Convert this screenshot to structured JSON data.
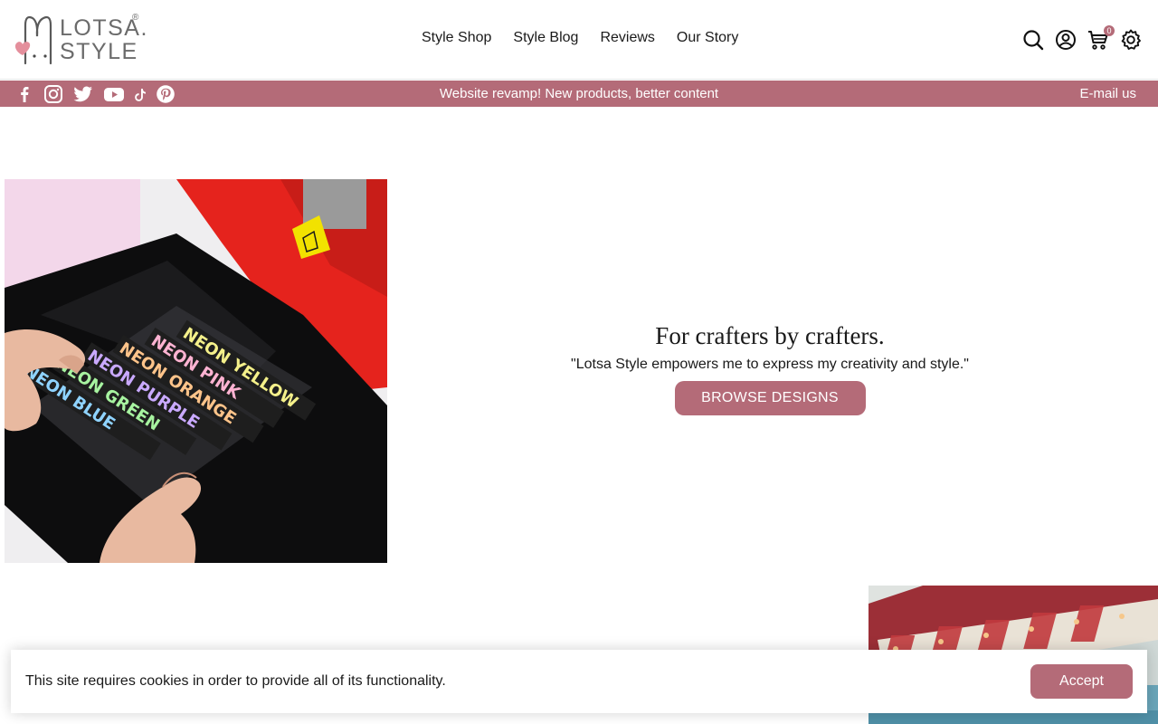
{
  "header": {
    "logo": {
      "line1": "LOTSA.",
      "line2": "STYLE",
      "registered": "®"
    },
    "nav": [
      "Style Shop",
      "Style Blog",
      "Reviews",
      "Our Story"
    ],
    "cart_count": "0",
    "icons": [
      "search-icon",
      "account-icon",
      "cart-icon",
      "settings-icon"
    ]
  },
  "announcement_bar": {
    "social_icons": [
      "facebook-icon",
      "instagram-icon",
      "twitter-icon",
      "youtube-icon",
      "tiktok-icon",
      "pinterest-icon"
    ],
    "message": "Website revamp! New products, better content",
    "email_label": "E-mail us"
  },
  "hero": {
    "title": "For crafters by crafters.",
    "quote": "\"Lotsa Style empowers me to express my creativity and style.\"",
    "button_label": "BROWSE DESIGNS",
    "image_labels": [
      "NEON YELLOW",
      "NEON PINK",
      "NEON ORANGE",
      "NEON PURPLE",
      "NEON GREEN",
      "NEON BLUE"
    ]
  },
  "cookie_banner": {
    "message": "This site requires cookies in order to provide all of its functionality.",
    "accept_label": "Accept"
  },
  "colors": {
    "accent": "#b46b78",
    "text": "#1a1a1a",
    "background": "#ffffff"
  }
}
